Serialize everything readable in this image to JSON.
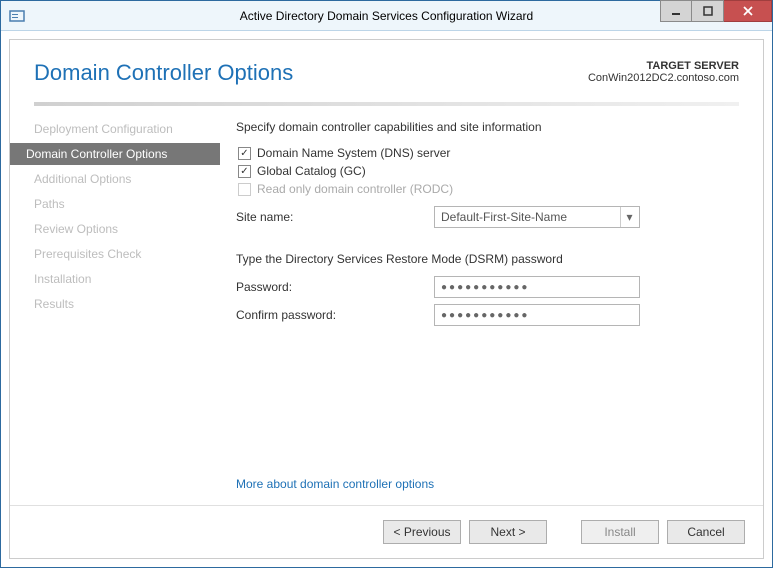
{
  "window": {
    "title": "Active Directory Domain Services Configuration Wizard"
  },
  "header": {
    "page_title": "Domain Controller Options",
    "target_label": "TARGET SERVER",
    "target_value": "ConWin2012DC2.contoso.com"
  },
  "sidebar": {
    "items": [
      {
        "label": "Deployment Configuration",
        "active": false
      },
      {
        "label": "Domain Controller Options",
        "active": true
      },
      {
        "label": "Additional Options",
        "active": false
      },
      {
        "label": "Paths",
        "active": false
      },
      {
        "label": "Review Options",
        "active": false
      },
      {
        "label": "Prerequisites Check",
        "active": false
      },
      {
        "label": "Installation",
        "active": false
      },
      {
        "label": "Results",
        "active": false
      }
    ]
  },
  "main": {
    "capabilities_heading": "Specify domain controller capabilities and site information",
    "dns_label": "Domain Name System (DNS) server",
    "dns_checked": true,
    "gc_label": "Global Catalog (GC)",
    "gc_checked": true,
    "rodc_label": "Read only domain controller (RODC)",
    "rodc_checked": false,
    "rodc_enabled": false,
    "site_name_label": "Site name:",
    "site_name_value": "Default-First-Site-Name",
    "dsrm_heading": "Type the Directory Services Restore Mode (DSRM) password",
    "password_label": "Password:",
    "password_value": "●●●●●●●●●●●",
    "confirm_label": "Confirm password:",
    "confirm_value": "●●●●●●●●●●●",
    "more_link": "More about domain controller options"
  },
  "footer": {
    "previous": "< Previous",
    "next": "Next >",
    "install": "Install",
    "cancel": "Cancel",
    "previous_enabled": true,
    "next_enabled": true,
    "install_enabled": false,
    "cancel_enabled": true
  }
}
